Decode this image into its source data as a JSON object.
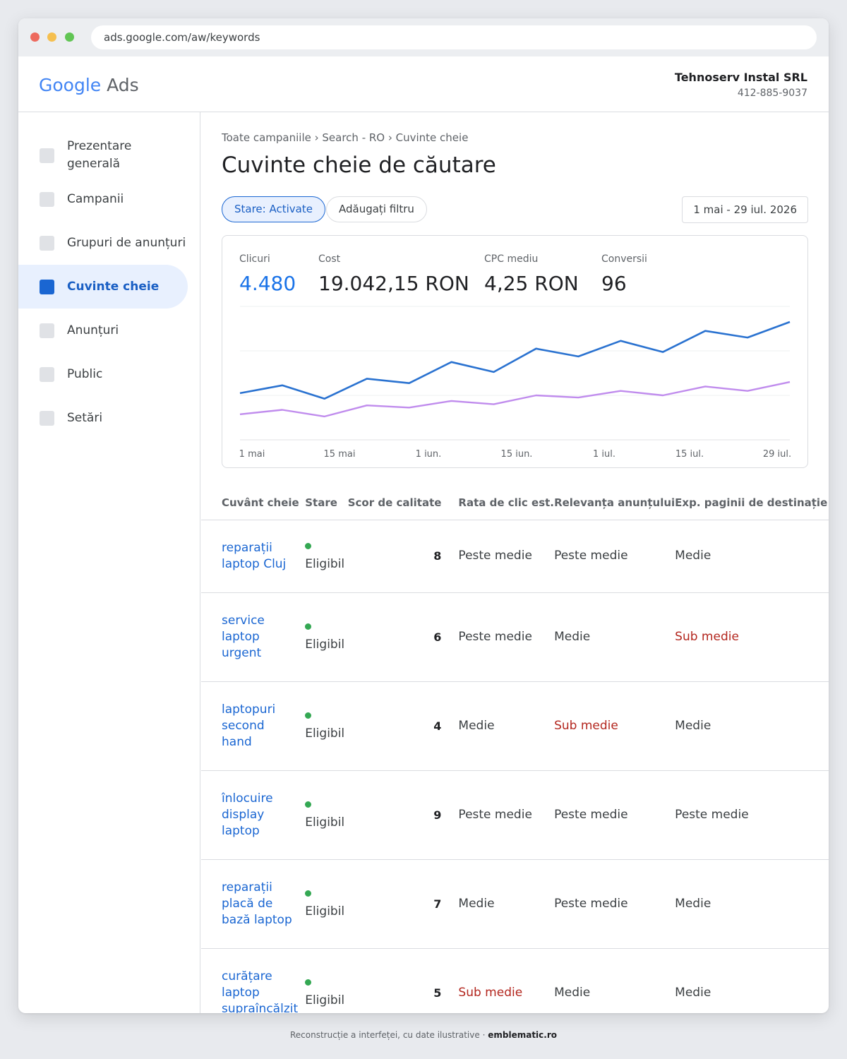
{
  "browser": {
    "url": "ads.google.com/aw/keywords"
  },
  "header": {
    "logo_google": "Google",
    "logo_ads": "Ads",
    "account_name": "Tehnoserv Instal SRL",
    "account_id": "412-885-9037"
  },
  "sidebar": {
    "items": [
      {
        "label": "Prezentare generală"
      },
      {
        "label": "Campanii"
      },
      {
        "label": "Grupuri de anunțuri"
      },
      {
        "label": "Cuvinte cheie"
      },
      {
        "label": "Anunțuri"
      },
      {
        "label": "Public"
      },
      {
        "label": "Setări"
      }
    ],
    "active": "Cuvinte cheie"
  },
  "main": {
    "breadcrumb": "Toate campaniile › Search - RO › Cuvinte cheie",
    "title": "Cuvinte cheie de căutare",
    "filter_chip": "Stare: Activate",
    "add_filter": "Adăugați filtru",
    "date_range": "1 mai - 29 iul. 2026"
  },
  "metrics": [
    {
      "label": "Clicuri",
      "value": "4.480"
    },
    {
      "label": "Cost",
      "value": "19.042,15 RON"
    },
    {
      "label": "CPC mediu",
      "value": "4,25 RON"
    },
    {
      "label": "Conversii",
      "value": "96"
    }
  ],
  "colors": {
    "accent": "#1a73e8",
    "series_clicks": "#2a72d0",
    "series_cost": "#c08ced",
    "status_green": "#34a853",
    "below_average": "#b3261e"
  },
  "chart_data": {
    "type": "line",
    "x_tick_labels": [
      "1 mai",
      "15 mai",
      "1 iun.",
      "15 iun.",
      "1 iul.",
      "15 iul.",
      "29 iul."
    ],
    "series": [
      {
        "values": [
          0.42,
          0.49,
          0.37,
          0.55,
          0.51,
          0.7,
          0.61,
          0.82,
          0.75,
          0.89,
          0.79,
          0.98,
          0.92,
          1.06
        ]
      },
      {
        "values": [
          0.23,
          0.27,
          0.21,
          0.31,
          0.29,
          0.35,
          0.32,
          0.4,
          0.38,
          0.44,
          0.4,
          0.48,
          0.44,
          0.52
        ]
      }
    ],
    "ylim": [
      0,
      1.2
    ],
    "grid": true
  },
  "table": {
    "headers": [
      "Cuvânt cheie",
      "Stare",
      "Scor de calitate",
      "Rata de clic est.",
      "Relevanța anunțului",
      "Exp. paginii de destinație"
    ],
    "rows": [
      {
        "keyword": "reparații laptop Cluj",
        "status": "Eligibil",
        "score": "8",
        "ctr": "Peste medie",
        "relevance": "Peste medie",
        "landing": "Medie"
      },
      {
        "keyword": "service laptop urgent",
        "status": "Eligibil",
        "score": "6",
        "ctr": "Peste medie",
        "relevance": "Medie",
        "landing": "Sub medie"
      },
      {
        "keyword": "laptopuri second hand",
        "status": "Eligibil",
        "score": "4",
        "ctr": "Medie",
        "relevance": "Sub medie",
        "landing": "Medie"
      },
      {
        "keyword": "înlocuire display laptop",
        "status": "Eligibil",
        "score": "9",
        "ctr": "Peste medie",
        "relevance": "Peste medie",
        "landing": "Peste medie"
      },
      {
        "keyword": "reparații placă de bază laptop",
        "status": "Eligibil",
        "score": "7",
        "ctr": "Medie",
        "relevance": "Peste medie",
        "landing": "Medie"
      },
      {
        "keyword": "curățare laptop supraîncălzit",
        "status": "Eligibil",
        "score": "5",
        "ctr": "Sub medie",
        "relevance": "Medie",
        "landing": "Medie"
      }
    ]
  },
  "footer": {
    "text": "Reconstrucție a interfeței, cu date ilustrative",
    "separator": "·",
    "brand": "emblematic.ro"
  }
}
